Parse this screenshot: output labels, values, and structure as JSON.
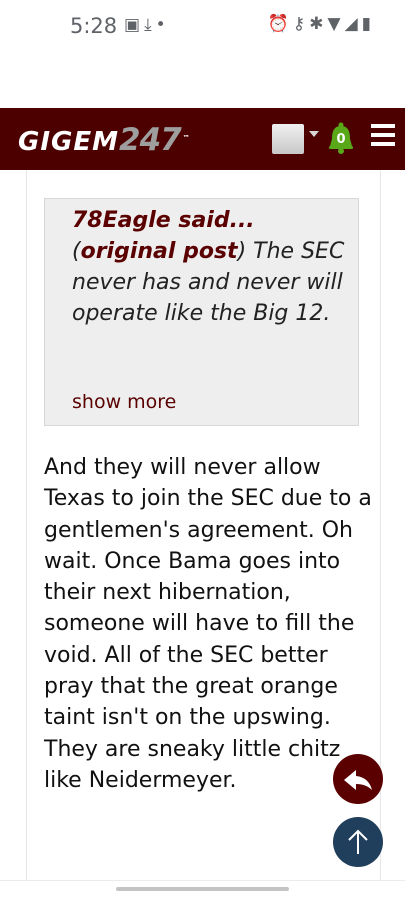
{
  "status_bar": {
    "time": "5:28",
    "left_icons": [
      "photo-icon",
      "download-icon",
      "dot-icon"
    ],
    "right_icons": [
      "alarm-icon",
      "key-icon",
      "bluetooth-icon",
      "wifi-icon",
      "signal-icon",
      "battery-icon"
    ]
  },
  "header": {
    "logo_word": "GIGEM",
    "logo_number": "247",
    "logo_mark": "™",
    "notification_count": "0",
    "brand_color": "#4d0000"
  },
  "quote": {
    "author": "78Eagle said...",
    "link_text": "original post",
    "open_paren": "(",
    "close_paren": ")",
    "text": " The SEC never has and never will operate like the Big 12.",
    "show_more": "show more"
  },
  "post": {
    "body": "And they will never allow Texas to join the SEC due to a gentlemen's agreement. Oh wait. Once Bama goes into their next hibernation, someone will have to fill the void. All of the SEC better pray that the great orange taint isn't on the upswing. They are sneaky little chitz like Neidermeyer."
  },
  "fabs": {
    "reply_icon": "reply-icon",
    "top_icon": "arrow-up-icon",
    "reply_color": "#5a0000",
    "top_color": "#203f5c"
  }
}
